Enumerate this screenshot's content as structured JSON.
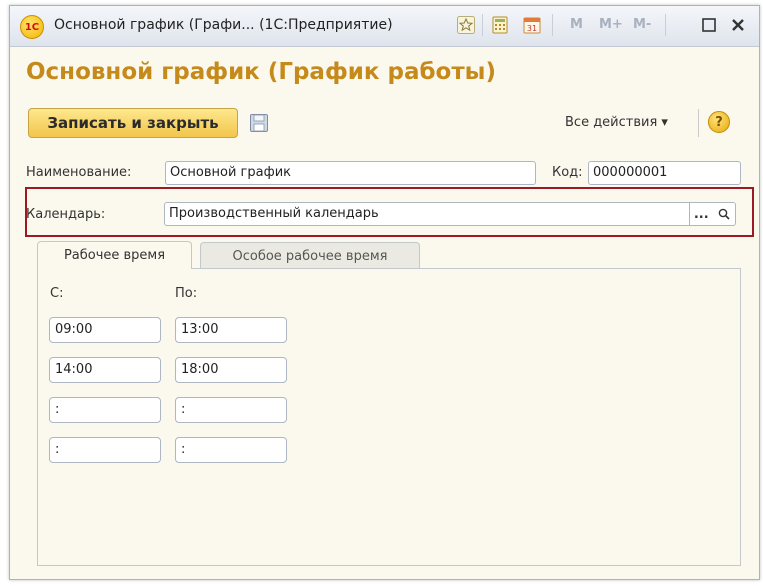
{
  "window": {
    "title": "Основной график (Графи...  (1С:Предприятие)",
    "logo_text": "1С",
    "memory_buttons": [
      "M",
      "M+",
      "M-"
    ]
  },
  "form": {
    "heading": "Основной график (График работы)",
    "save_close_label": "Записать и закрыть",
    "all_actions_label": "Все действия ▾",
    "help_label": "?"
  },
  "fields": {
    "name_label": "Наименование:",
    "name_value": "Основной график",
    "code_label": "Код:",
    "code_value": "000000001",
    "calendar_label": "Календарь:",
    "calendar_value": "Производственный календарь",
    "calendar_select": "...",
    "calendar_search_icon": "search-icon"
  },
  "tabs": [
    {
      "label": "Рабочее время",
      "active": true
    },
    {
      "label": "Особое рабочее время",
      "active": false
    }
  ],
  "schedule": {
    "from_label": "С:",
    "to_label": "По:",
    "rows": [
      {
        "from": "09:00",
        "to": "13:00"
      },
      {
        "from": "14:00",
        "to": "18:00"
      },
      {
        "from": ":",
        "to": ":"
      },
      {
        "from": ":",
        "to": ":"
      }
    ]
  },
  "colors": {
    "heading": "#c68a1a",
    "highlight_border": "#9c1b22",
    "save_button": "#f3c54b"
  }
}
